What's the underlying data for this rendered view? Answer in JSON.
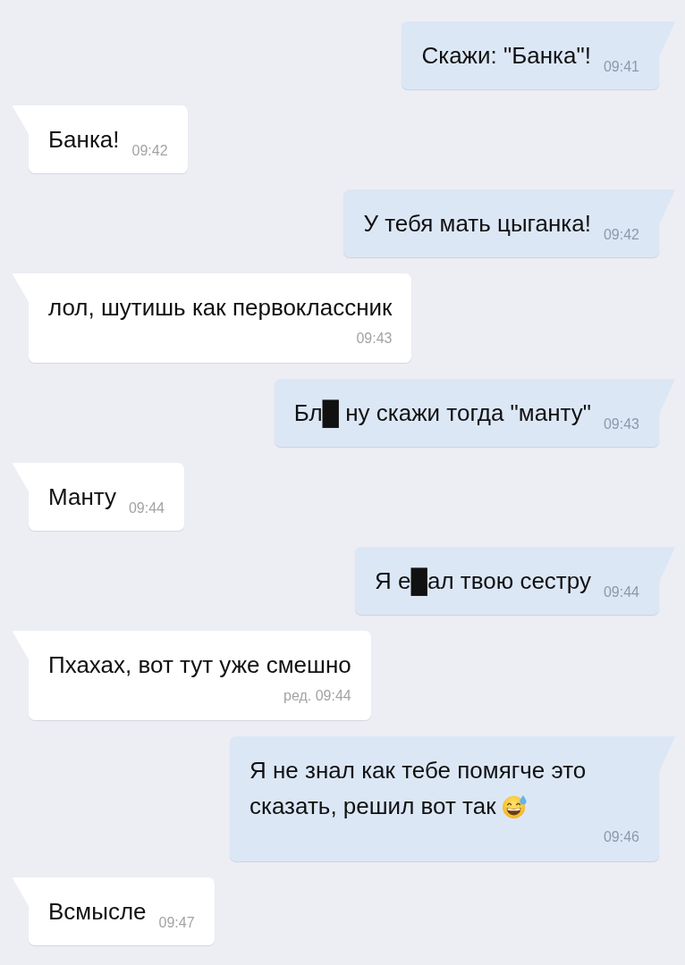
{
  "messages": [
    {
      "kind": "outgoing",
      "time_below": false,
      "text": "Скажи: \"Банка\"!",
      "time": "09:41"
    },
    {
      "kind": "incoming",
      "time_below": false,
      "text": "Банка!",
      "time": "09:42"
    },
    {
      "kind": "outgoing",
      "time_below": false,
      "text": "У тебя мать цыганка!",
      "time": "09:42"
    },
    {
      "kind": "incoming",
      "time_below": true,
      "text": "лол, шутишь как первоклассник",
      "time": "09:43"
    },
    {
      "kind": "outgoing",
      "time_below": false,
      "text": "Бл█ ну скажи тогда \"манту\"",
      "time": "09:43"
    },
    {
      "kind": "incoming",
      "time_below": false,
      "text": "Манту",
      "time": "09:44"
    },
    {
      "kind": "outgoing",
      "time_below": false,
      "text": "Я е█ал твою сестру",
      "time": "09:44"
    },
    {
      "kind": "incoming",
      "time_below": true,
      "text": "Пхахах, вот тут уже смешно",
      "time": "ред. 09:44"
    },
    {
      "kind": "outgoing",
      "time_below": true,
      "text": "Я не знал как тебе помягче это сказать, решил вот так",
      "time": "09:46",
      "emoji": true
    },
    {
      "kind": "incoming",
      "time_below": false,
      "text": "Всмысле",
      "time": "09:47"
    }
  ]
}
